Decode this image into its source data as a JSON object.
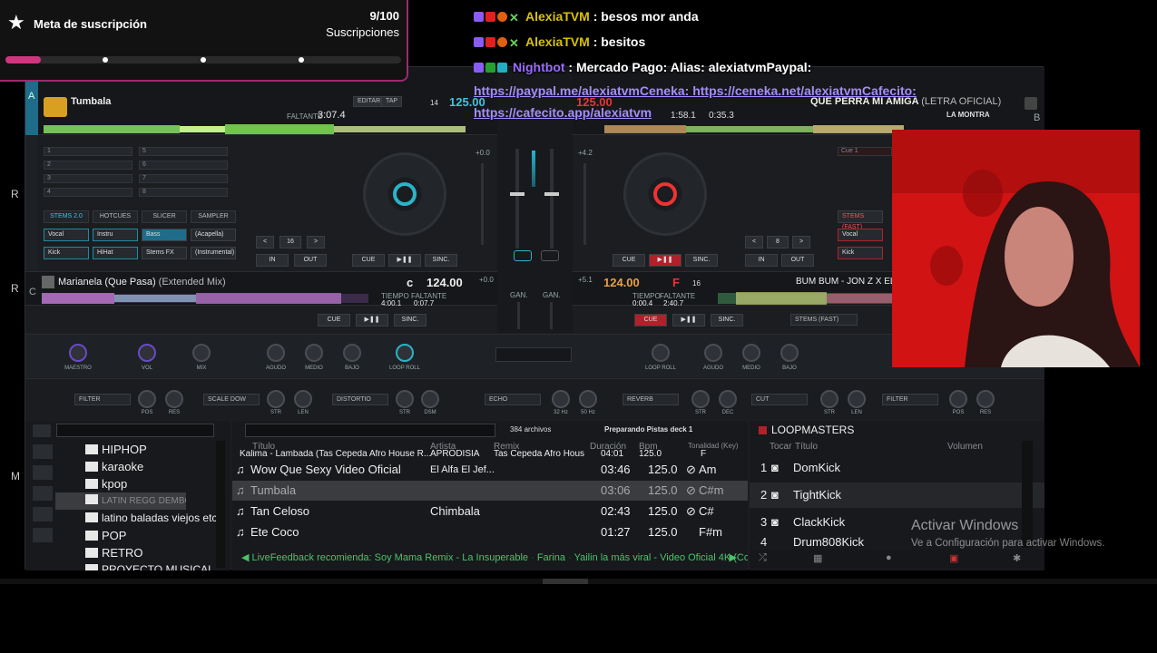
{
  "goal": {
    "title": "Meta de suscripción",
    "count": "9/100",
    "unit": "Suscripciones",
    "progress": 0.09
  },
  "chat": {
    "line1": {
      "user": "AlexiaTVM",
      "message": ": besos mor anda"
    },
    "line2": {
      "user": "AlexiaTVM",
      "message": ": besitos"
    },
    "line3": {
      "user": "Nightbot",
      "message": ": Mercado Pago: Alias: alexiatvmPaypal:"
    },
    "link1": "https://paypal.me/alexiatvmCeneka: https://ceneka.net/alexiatvmCafecito:",
    "link2": "https://cafecito.app/alexiatvm"
  },
  "deck_a": {
    "letter": "A",
    "title": "Tumbala",
    "remaining_label": "FALTANTE",
    "time": "3:07.4",
    "edit": "EDITAR",
    "tap": "TAP",
    "bpm": "125.00",
    "beat": "14",
    "pad_numbers": [
      "1",
      "2",
      "3",
      "4",
      "5",
      "6",
      "7",
      "8"
    ],
    "stems_tab": "STEMS 2.0",
    "hotcues_tab": "HOTCUES",
    "slicer_tab": "SLICER",
    "sampler_tab": "SAMPLER",
    "stem_buttons": [
      "Vocal",
      "Instru",
      "Bass",
      "(Acapella)",
      "Kick",
      "HiHat",
      "Stems FX",
      "(Instrumental)"
    ],
    "loop_value": "16",
    "in": "IN",
    "out": "OUT",
    "cue": "CUE",
    "play": "▶❚❚",
    "sync": "SINC.",
    "pitch": "+0.0"
  },
  "deck_b": {
    "letter": "B",
    "title": "QUE PERRA MI AMIGA",
    "title_suffix": "(LETRA OFICIAL)",
    "artist": "LA MONTRA",
    "bpm": "125.00",
    "time1": "1:58.1",
    "time2": "0:35.3",
    "pitch": "+4.2",
    "loop_value": "8",
    "in": "IN",
    "out": "OUT",
    "cue": "CUE",
    "play": "▶❚❚",
    "sync": "SINC.",
    "stems_label": "STEMS (FAST)",
    "stem_buttons": [
      "Vocal",
      "Kick"
    ],
    "cue_label": "Cue 1"
  },
  "deck_c": {
    "letter": "C",
    "title": "Marianela (Que Pasa)",
    "title_suffix": "(Extended Mix)",
    "key": "c",
    "bpm": "124.00",
    "time_label": "TIEMPO",
    "remaining_label": "FALTANTE",
    "time": "4:00.1",
    "remaining": "0:07.7",
    "pitch": "+0.0",
    "cue": "CUE",
    "play": "▶❚❚",
    "sync": "SINC."
  },
  "deck_d": {
    "title": "BUM BUM - JON Z X EL",
    "bpm": "124.00",
    "key": "F",
    "beat": "16",
    "time_label": "TIEMPO",
    "remaining_label": "FALTANTE",
    "time": "0:00.4",
    "remaining": "2:40.7",
    "pitch": "+5.1",
    "cue": "CUE",
    "play": "▶❚❚",
    "sync": "SINC.",
    "stems": "STEMS (FAST)"
  },
  "mixer": {
    "gain_a": "GAN.",
    "gain_b": "GAN.",
    "master": "MAESTRO",
    "vol": "VOL",
    "mix": "MIX",
    "agudo": "AGUDO",
    "medio": "MEDIO",
    "bajo": "BAJO",
    "loop_roll": "LOOP ROLL"
  },
  "fx": {
    "a1": "FILTER",
    "a2": "SCALE DOW",
    "a3": "DISTORTIO",
    "a4": "ECHO",
    "b1": "REVERB",
    "b2": "CUT",
    "b3": "FILTER",
    "pos": "POS",
    "res": "RES",
    "str": "STR",
    "len": "LEN",
    "dsm": "DSM",
    "hz32": "32 Hz",
    "hz50": "50 Hz",
    "dec": "DEC"
  },
  "browser": {
    "count": "384 archivos",
    "status": "Preparando Pistas deck 1",
    "folders": [
      "HIPHOP",
      "karaoke",
      "kpop",
      "LATIN REGG DEMBOW BR AF",
      "latino baladas viejos etc",
      "POP",
      "RETRO",
      "PROYECTO MUSICAL"
    ],
    "columns": {
      "title": "Título",
      "artist": "Artista",
      "remix": "Remix",
      "duration": "Duración",
      "bpm": "Bpm",
      "key": "Tonalidad (Key)"
    },
    "tracks": [
      {
        "title": "Kalima - Lambada (Tas Cepeda Afro House R...",
        "artist": "APRODISIA",
        "remix": "Tas Cepeda Afro Hous...",
        "duration": "04:01",
        "bpm": "125.0",
        "key": "F"
      },
      {
        "title": "Wow Que Sexy  Video Oficial",
        "artist": "El Alfa El Jef...",
        "remix": "",
        "duration": "03:46",
        "bpm": "125.0",
        "key": "Am"
      },
      {
        "title": "Tumbala",
        "artist": "",
        "remix": "",
        "duration": "03:06",
        "bpm": "125.0",
        "key": "C#m"
      },
      {
        "title": "Tan Celoso",
        "artist": "Chimbala",
        "remix": "",
        "duration": "02:43",
        "bpm": "125.0",
        "key": "C#"
      },
      {
        "title": "Ete Coco",
        "artist": "",
        "remix": "",
        "duration": "01:27",
        "bpm": "125.0",
        "key": "F#m"
      }
    ],
    "feedback": "LiveFeedback recomienda: Soy Mama Remix - La Insuperable",
    "feedback2": "Farina",
    "feedback3": "Yailin la más viral - Video Oficial 4K (Com"
  },
  "loopmasters": {
    "title": "LOOPMASTERS",
    "col_play": "Tocar",
    "col_title": "Título",
    "col_volume": "Volumen",
    "items": [
      {
        "n": "1",
        "name": "DomKick"
      },
      {
        "n": "2",
        "name": "TightKick"
      },
      {
        "n": "3",
        "name": "ClackKick"
      },
      {
        "n": "4",
        "name": "Drum808Kick"
      }
    ]
  },
  "activate": {
    "title": "Activar Windows",
    "subtitle": "Ve a Configuración para activar Windows."
  },
  "edge_letters": [
    "R",
    "R",
    "M"
  ]
}
